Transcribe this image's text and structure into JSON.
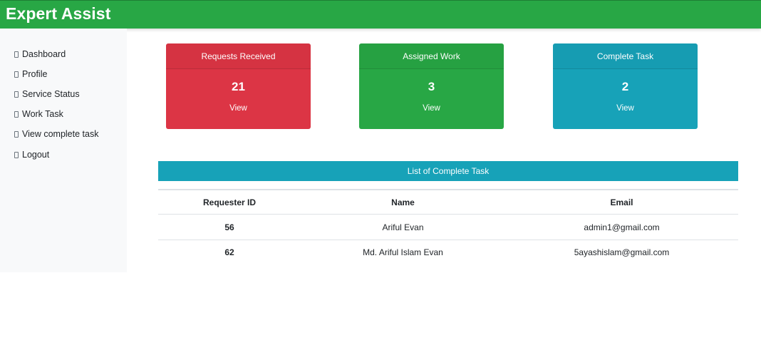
{
  "header": {
    "brand": "Expert Assist"
  },
  "sidebar": {
    "items": [
      {
        "label": "Dashboard"
      },
      {
        "label": "Profile"
      },
      {
        "label": "Service Status"
      },
      {
        "label": "Work Task"
      },
      {
        "label": "View complete task"
      },
      {
        "label": "Logout"
      }
    ]
  },
  "cards": [
    {
      "title": "Requests Received",
      "count": "21",
      "link": "View",
      "color": "#dc3545"
    },
    {
      "title": "Assigned Work",
      "count": "3",
      "link": "View",
      "color": "#28a745"
    },
    {
      "title": "Complete Task",
      "count": "2",
      "link": "View",
      "color": "#17a2b8"
    }
  ],
  "table": {
    "title": "List of Complete Task",
    "columns": [
      "Requester ID",
      "Name",
      "Email"
    ],
    "rows": [
      [
        "56",
        "Ariful Evan",
        "admin1@gmail.com"
      ],
      [
        "62",
        "Md. Ariful Islam Evan",
        "5ayashislam@gmail.com"
      ]
    ]
  }
}
